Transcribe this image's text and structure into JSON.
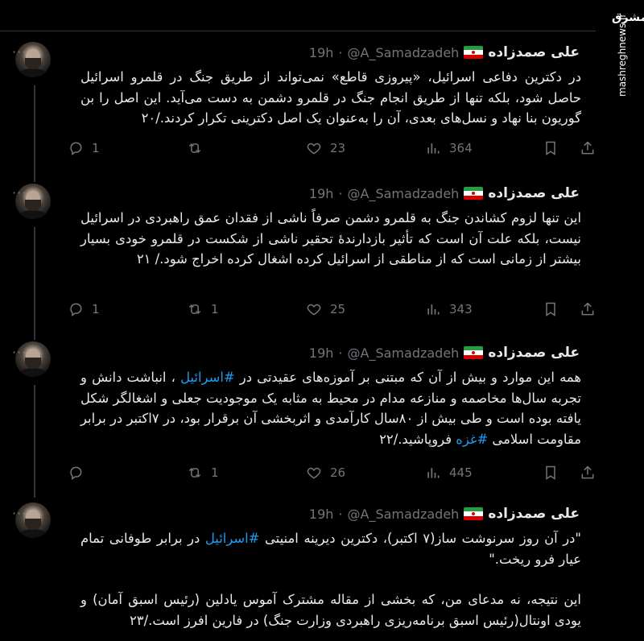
{
  "watermark": {
    "logo_text": "مشرق",
    "site": "mashreghnews.ir"
  },
  "author": {
    "name": "علی صمدزاده",
    "handle": "@A_Samadzadeh",
    "dot": "·",
    "time": "19h",
    "more": "···"
  },
  "tweets": [
    {
      "text": "در دکترین دفاعی اسرائیل، «پیروزی قاطع» نمی‌تواند از طریق جنگ در قلمرو اسرائیل حاصل شود، بلکه تنها از طریق انجام جنگ در قلمرو دشمن به دست می‌آید. این اصل را بن گوریون بنا نهاد و نسل‌های بعدی، آن را به‌عنوان یک اصل دکترینی تکرار کردند./۲۰",
      "replies": "1",
      "retweets": "",
      "likes": "23",
      "views": "364"
    },
    {
      "text": "این تنها لزوم کشاندن جنگ به قلمرو دشمن صرفاً ناشی از فقدان عمق راهبردی در اسرائیل نیست، بلکه علت آن است که تأثیر بازدارندهٔ تحقیر ناشی از شکست در قلمرو خودی بسیار بیشتر از زمانی است که از مناطقی از اسرائیل کرده اشغال کرده اخراج شود./ ۲۱",
      "replies": "1",
      "retweets": "1",
      "likes": "25",
      "views": "343"
    },
    {
      "text_before": "همه این موارد و بیش از آن که مبتنی بر آموزه‌های عقیدتی در ",
      "hashtag1": "#اسرائیل",
      "text_middle": " ، انباشت دانش و تجربه سال‌ها مخاصمه و منازعه مدام در محیط به مثابه یک موجودیت جعلی و اشغالگر شکل یافته بوده است و طی بیش از ۸۰سال کارآمدی و اثربخشی آن برقرار بود، در ۷اکتبر در برابر مقاومت اسلامی ",
      "hashtag2": "#غزه",
      "text_after": " فروپاشید./۲۲",
      "replies": "",
      "retweets": "1",
      "likes": "26",
      "views": "445"
    },
    {
      "text_before": "\"در آن روز سرنوشت ساز(۷ اکتبر)، دکترین دیرینه امنیتی ",
      "hashtag1": "#اسرائیل",
      "text_after": " در برابر طوفانی تمام عیار فرو ریخت.\"",
      "text_p2": "این نتیجه، نه مدعای من، که بخشی از مقاله مشترک آموس یادلین (رئیس اسبق آمان) و یودی اونتال(رئیس اسبق برنامه‌ریزی راهبردی وزارت جنگ) در فارین افرز است./۲۳"
    }
  ]
}
